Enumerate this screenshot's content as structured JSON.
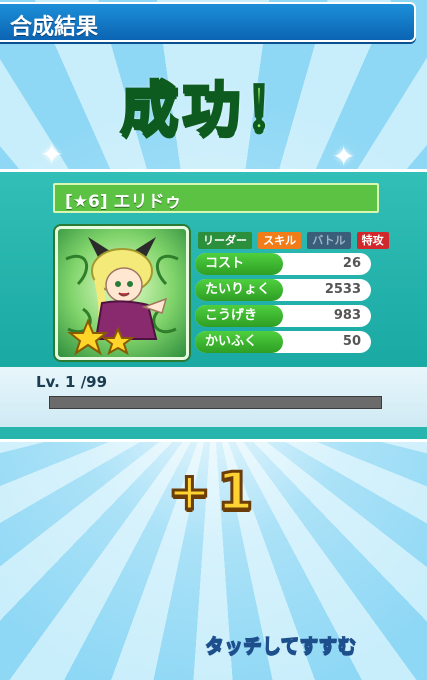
{
  "header": {
    "title": "合成結果"
  },
  "result": {
    "banner": "成功！"
  },
  "monster": {
    "name": "[★6] エリドゥ",
    "tags": [
      {
        "label": "リーダー",
        "color": "#2b8f3c"
      },
      {
        "label": "スキル",
        "color": "#f07d1a"
      },
      {
        "label": "バトル",
        "color": "#3a5e7a"
      },
      {
        "label": "特攻",
        "color": "#d0282b"
      }
    ],
    "stats": [
      {
        "label": "コスト",
        "value": "26"
      },
      {
        "label": "たいりょく",
        "value": "2533"
      },
      {
        "label": "こうげき",
        "value": "983"
      },
      {
        "label": "かいふく",
        "value": "50"
      }
    ],
    "level_text": "Lv. 1 /99",
    "level_progress": 0.0
  },
  "bonus": {
    "text": "+1"
  },
  "prompt": {
    "text": "タッチしてすすむ"
  }
}
